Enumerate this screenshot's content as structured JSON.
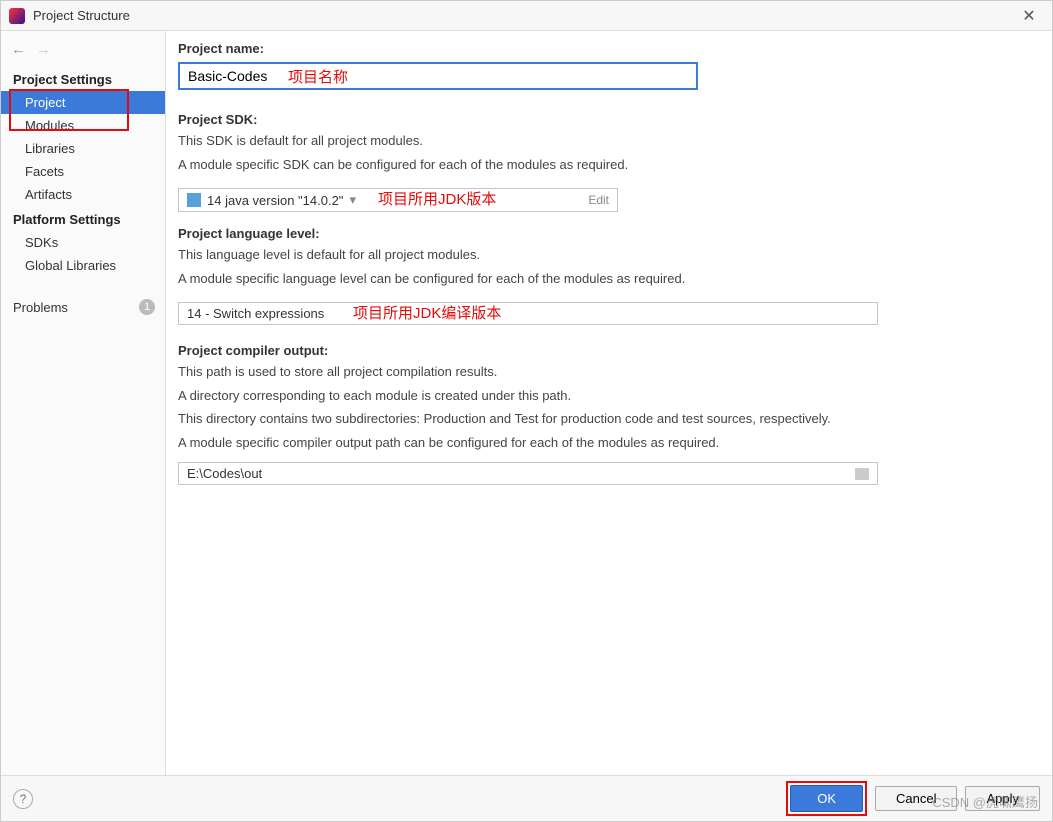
{
  "window": {
    "title": "Project Structure"
  },
  "sidebar": {
    "project_settings_header": "Project Settings",
    "platform_settings_header": "Platform Settings",
    "items": {
      "project": "Project",
      "modules": "Modules",
      "libraries": "Libraries",
      "facets": "Facets",
      "artifacts": "Artifacts",
      "sdks": "SDKs",
      "global_libraries": "Global Libraries",
      "problems": "Problems"
    },
    "problems_count": "1"
  },
  "main": {
    "project_name_label": "Project name:",
    "project_name_value": "Basic-Codes",
    "project_sdk_label": "Project SDK:",
    "sdk_desc_1": "This SDK is default for all project modules.",
    "sdk_desc_2": "A module specific SDK can be configured for each of the modules as required.",
    "sdk_value": "14 java version \"14.0.2\"",
    "sdk_edit": "Edit",
    "lang_level_label": "Project language level:",
    "lang_desc_1": "This language level is default for all project modules.",
    "lang_desc_2": "A module specific language level can be configured for each of the modules as required.",
    "lang_value": "14 - Switch expressions",
    "output_label": "Project compiler output:",
    "output_desc_1": "This path is used to store all project compilation results.",
    "output_desc_2": "A directory corresponding to each module is created under this path.",
    "output_desc_3": "This directory contains two subdirectories: Production and Test for production code and test sources, respectively.",
    "output_desc_4": "A module specific compiler output path can be configured for each of the modules as required.",
    "output_value": "E:\\Codes\\out"
  },
  "annotations": {
    "name": "项目名称",
    "sdk": "项目所用JDK版本",
    "lang": "项目所用JDK编译版本"
  },
  "footer": {
    "ok": "OK",
    "cancel": "Cancel",
    "apply": "Apply"
  },
  "watermark": "CSDN @虎啸鹰扬"
}
